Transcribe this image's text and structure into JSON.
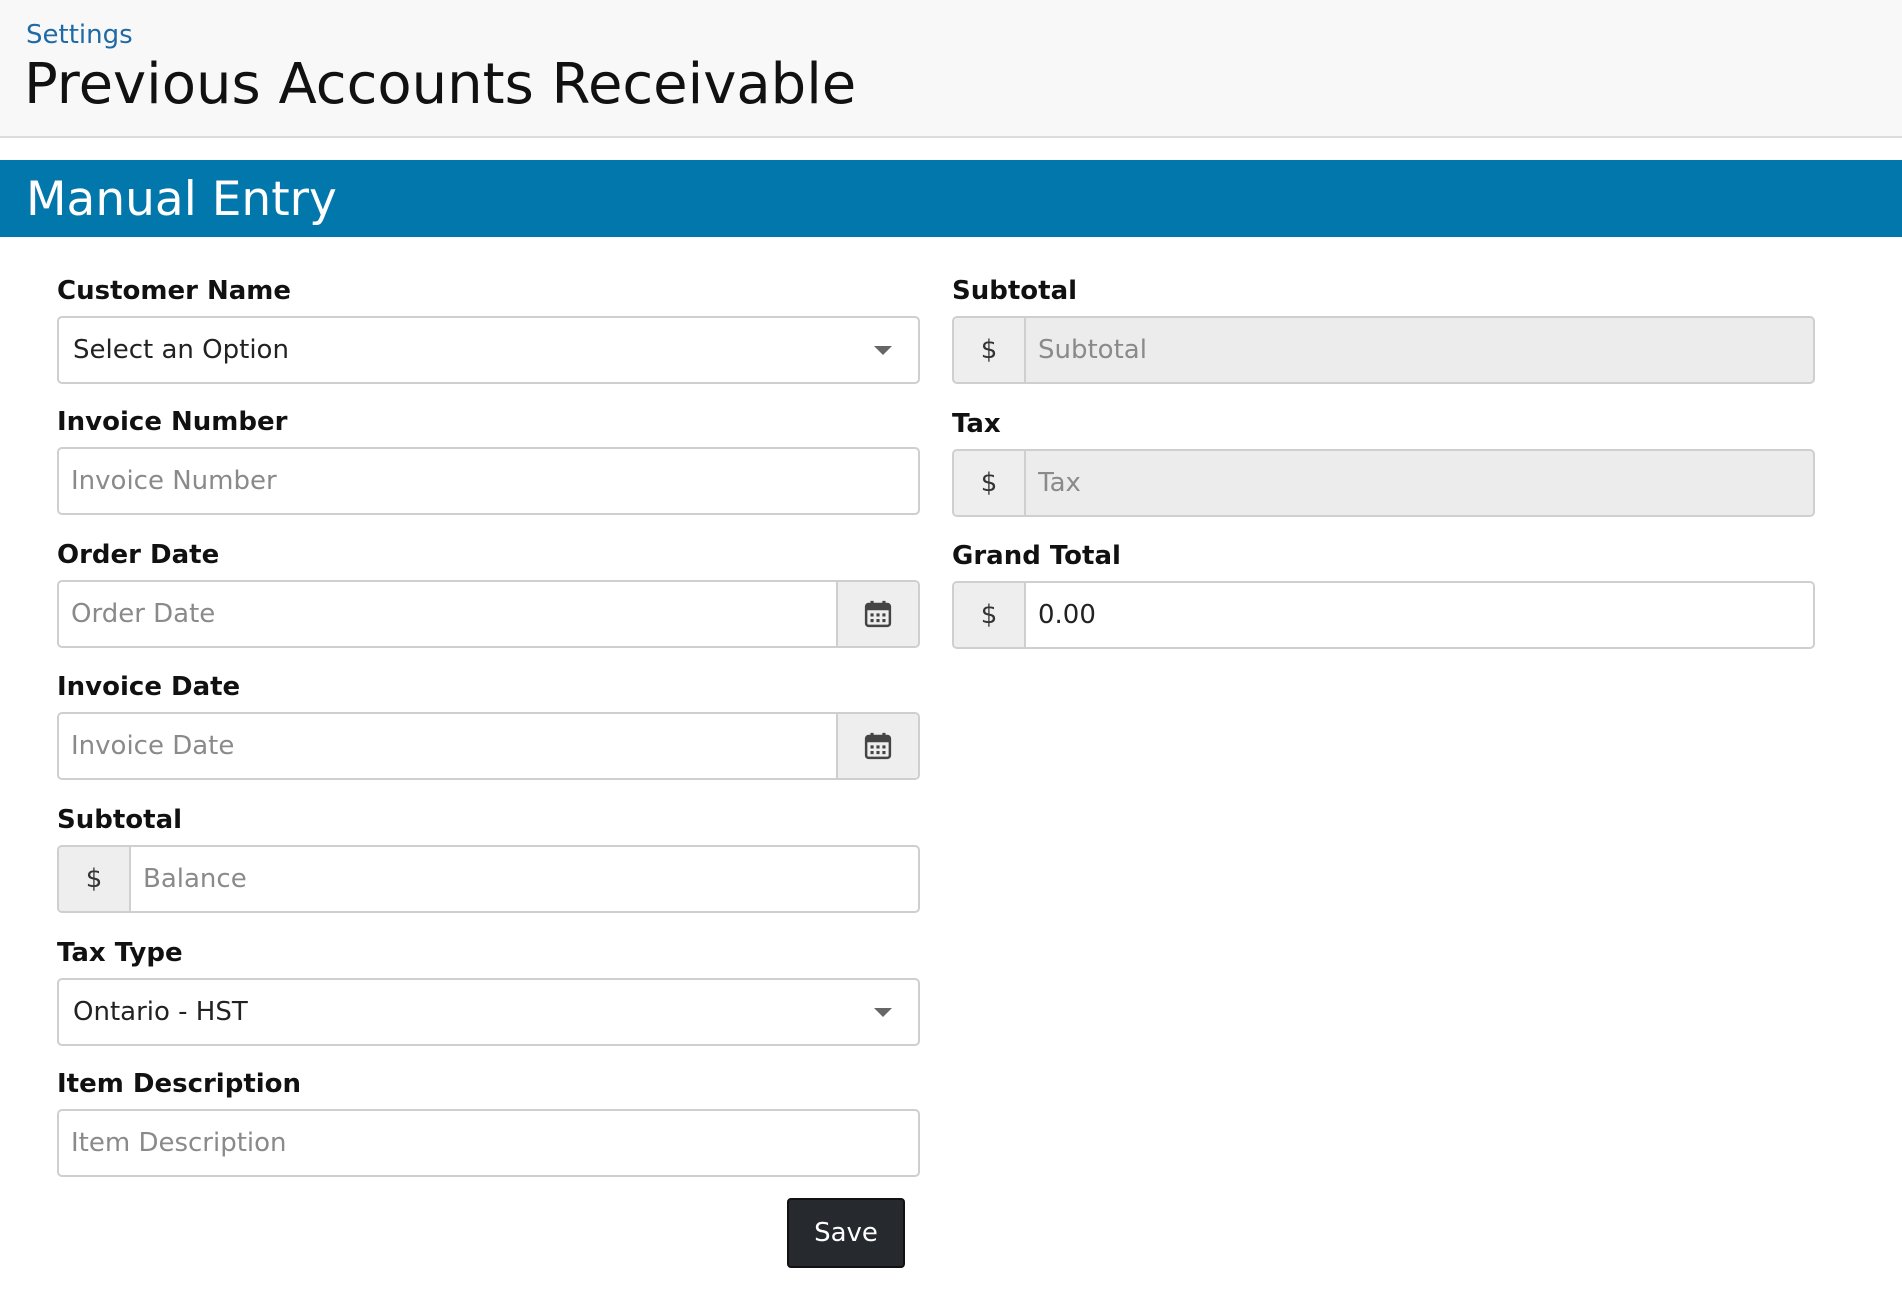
{
  "header": {
    "breadcrumb": "Settings",
    "title": "Previous Accounts Receivable"
  },
  "section": {
    "title": "Manual Entry"
  },
  "left": {
    "customer_name": {
      "label": "Customer Name",
      "value": "Select an Option"
    },
    "invoice_number": {
      "label": "Invoice Number",
      "placeholder": "Invoice Number"
    },
    "order_date": {
      "label": "Order Date",
      "placeholder": "Order Date"
    },
    "invoice_date": {
      "label": "Invoice Date",
      "placeholder": "Invoice Date"
    },
    "subtotal": {
      "label": "Subtotal",
      "prefix": "$",
      "placeholder": "Balance"
    },
    "tax_type": {
      "label": "Tax Type",
      "value": "Ontario - HST"
    },
    "item_description": {
      "label": "Item Description",
      "placeholder": "Item Description"
    }
  },
  "right": {
    "subtotal": {
      "label": "Subtotal",
      "prefix": "$",
      "placeholder": "Subtotal"
    },
    "tax": {
      "label": "Tax",
      "prefix": "$",
      "placeholder": "Tax"
    },
    "grand_total": {
      "label": "Grand Total",
      "prefix": "$",
      "value": "0.00"
    }
  },
  "actions": {
    "save_label": "Save"
  },
  "icons": {
    "calendar": "calendar-icon",
    "dropdown": "chevron-down-icon"
  },
  "colors": {
    "accent": "#0277ab",
    "link": "#1f6aa5",
    "button": "#262a2e"
  }
}
